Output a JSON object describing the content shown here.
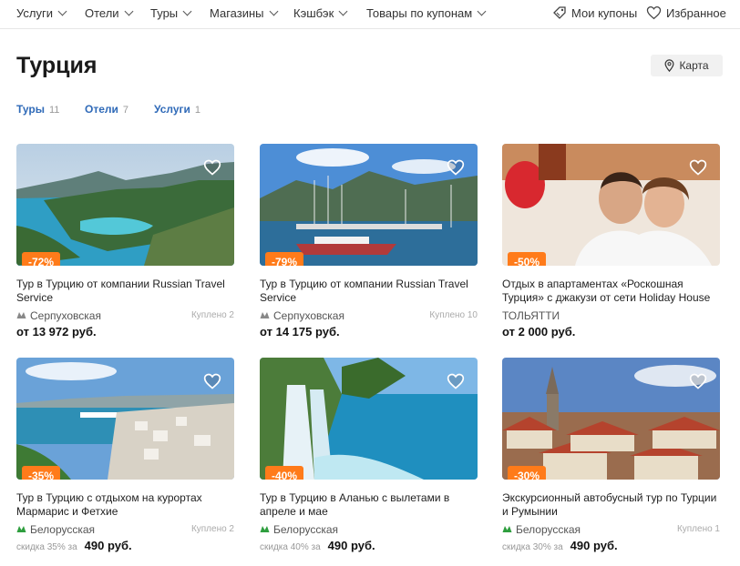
{
  "nav": {
    "items": [
      "Услуги",
      "Отели",
      "Туры",
      "Магазины",
      "Кэшбэк",
      "Товары по купонам"
    ],
    "coupons": "Мои купоны",
    "favorites": "Избранное"
  },
  "page": {
    "title": "Турция",
    "map_button": "Карта"
  },
  "tabs": [
    {
      "label": "Туры",
      "count": "11"
    },
    {
      "label": "Отели",
      "count": "7"
    },
    {
      "label": "Услуги",
      "count": "1"
    }
  ],
  "cards": [
    {
      "discount": "-72%",
      "title": "Тур в Турцию от компании Russian Travel Service",
      "location": "Серпуховская",
      "metro_color": "#888888",
      "bought": "Куплено 2",
      "price": "от 13 972 руб."
    },
    {
      "discount": "-79%",
      "title": "Тур в Турцию от компании Russian Travel Service",
      "location": "Серпуховская",
      "metro_color": "#888888",
      "bought": "Куплено 10",
      "price": "от 14 175 руб."
    },
    {
      "discount": "-50%",
      "title": "Отдых в апартаментах «Роскошная Турция» с джакузи от сети Holiday House",
      "location": "ТОЛЬЯТТИ",
      "bought": "",
      "price": "от 2 000 руб."
    },
    {
      "discount": "-35%",
      "title": "Тур в Турцию с отдыхом на курортах Мармарис и Фетхие",
      "location": "Белорусская",
      "metro_color": "#2e9e3e",
      "bought": "Куплено 2",
      "price_note": "скидка 35% за",
      "price": "490 руб."
    },
    {
      "discount": "-40%",
      "title": "Тур в Турцию в Аланью с вылетами в апреле и мае",
      "location": "Белорусская",
      "metro_color": "#2e9e3e",
      "bought": "",
      "price_note": "скидка 40% за",
      "price": "490 руб."
    },
    {
      "discount": "-30%",
      "title": "Экскурсионный автобусный тур по Турции и Румынии",
      "location": "Белорусская",
      "metro_color": "#2e9e3e",
      "bought": "Куплено 1",
      "price_note": "скидка 30% за",
      "price": "490 руб."
    }
  ],
  "colors": {
    "accent": "#ff7b1a",
    "link": "#2f6ab8"
  }
}
